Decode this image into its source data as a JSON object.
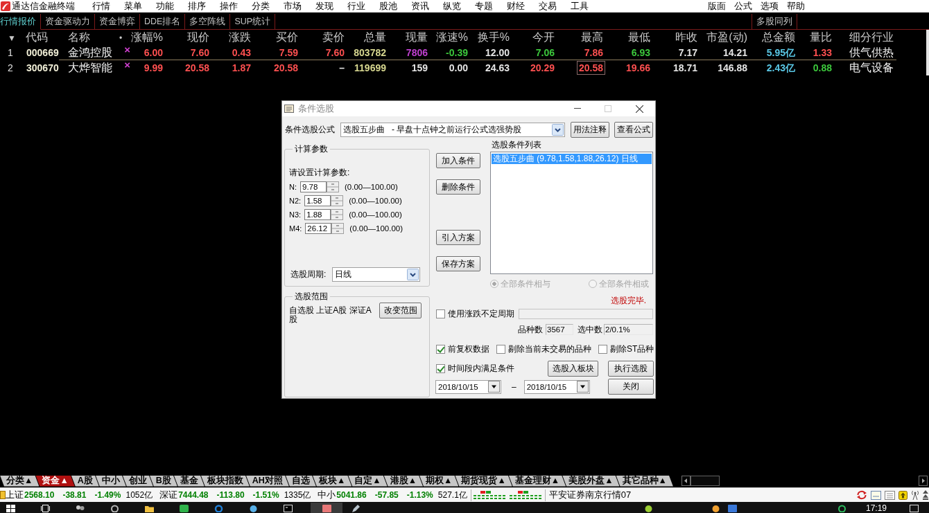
{
  "app": {
    "title": "通达信金融终端",
    "menu": [
      "行情",
      "菜单",
      "功能",
      "排序",
      "操作",
      "分类",
      "市场",
      "发现",
      "行业",
      "股池",
      "资讯",
      "纵览",
      "专题",
      "财经",
      "交易",
      "工具"
    ],
    "menu_right": [
      "版面",
      "公式",
      "选项",
      "帮助"
    ]
  },
  "view_tabs": [
    {
      "label": "行情报价",
      "selected": true
    },
    {
      "label": "资金驱动力",
      "selected": false
    },
    {
      "label": "资金博弈",
      "selected": false
    },
    {
      "label": "DDE排名",
      "selected": false
    },
    {
      "label": "多空阵线",
      "selected": false
    },
    {
      "label": "SUP统计",
      "selected": false
    }
  ],
  "view_tabs_right": [
    {
      "label": "多股同列",
      "selected": false
    }
  ],
  "quote_table": {
    "columns": [
      "▼",
      "代码",
      "名称",
      "•",
      "涨幅%",
      "现价",
      "涨跌",
      "买价",
      "卖价",
      "总量",
      "现量",
      "涨速%",
      "换手%",
      "今开",
      "最高",
      "最低",
      "昨收",
      "市盈(动)",
      "总金额",
      "量比",
      "细分行业"
    ],
    "rows": [
      {
        "selected": true,
        "cells": [
          {
            "text": "1",
            "color": "#e0e0e0",
            "boxed": false
          },
          {
            "text": "000669",
            "color": "#f2f0d8",
            "boxed": false
          },
          {
            "text": "金鸿控股",
            "color": "#f2f2f2",
            "boxed": false
          },
          {
            "text": "×",
            "color": "#d040d0",
            "boxed": false
          },
          {
            "text": "6.00",
            "color": "#ff5050",
            "boxed": false
          },
          {
            "text": "7.60",
            "color": "#ff5050",
            "boxed": false
          },
          {
            "text": "0.43",
            "color": "#ff5050",
            "boxed": false
          },
          {
            "text": "7.59",
            "color": "#ff5050",
            "boxed": false
          },
          {
            "text": "7.60",
            "color": "#ff5050",
            "boxed": false
          },
          {
            "text": "803782",
            "color": "#d8d890",
            "boxed": false
          },
          {
            "text": "7806",
            "color": "#c040d0",
            "boxed": false
          },
          {
            "text": "-0.39",
            "color": "#3cc83c",
            "boxed": false
          },
          {
            "text": "12.00",
            "color": "#e6e6e6",
            "boxed": false
          },
          {
            "text": "7.06",
            "color": "#3cc83c",
            "boxed": false
          },
          {
            "text": "7.86",
            "color": "#ff5050",
            "boxed": false
          },
          {
            "text": "6.93",
            "color": "#3cc83c",
            "boxed": false
          },
          {
            "text": "7.17",
            "color": "#e6e6e6",
            "boxed": false
          },
          {
            "text": "14.21",
            "color": "#e6e6e6",
            "boxed": false
          },
          {
            "text": "5.95亿",
            "color": "#5ac8e6",
            "boxed": false
          },
          {
            "text": "1.33",
            "color": "#ff5050",
            "boxed": false
          },
          {
            "text": "供气供热",
            "color": "#f2f2f2",
            "boxed": false
          }
        ]
      },
      {
        "selected": false,
        "cells": [
          {
            "text": "2",
            "color": "#e0e0e0",
            "boxed": false
          },
          {
            "text": "300670",
            "color": "#f2f0d8",
            "boxed": false
          },
          {
            "text": "大烨智能",
            "color": "#f2f2f2",
            "boxed": false
          },
          {
            "text": "×",
            "color": "#d040d0",
            "boxed": false
          },
          {
            "text": "9.99",
            "color": "#ff5050",
            "boxed": false
          },
          {
            "text": "20.58",
            "color": "#ff5050",
            "boxed": false
          },
          {
            "text": "1.87",
            "color": "#ff5050",
            "boxed": false
          },
          {
            "text": "20.58",
            "color": "#ff5050",
            "boxed": false
          },
          {
            "text": "–",
            "color": "#e6e6e6",
            "boxed": false
          },
          {
            "text": "119699",
            "color": "#d8d890",
            "boxed": false
          },
          {
            "text": "159",
            "color": "#e6e6e6",
            "boxed": false
          },
          {
            "text": "0.00",
            "color": "#e6e6e6",
            "boxed": false
          },
          {
            "text": "24.63",
            "color": "#e6e6e6",
            "boxed": false
          },
          {
            "text": "20.29",
            "color": "#ff5050",
            "boxed": false
          },
          {
            "text": "20.58",
            "color": "#ff5050",
            "boxed": true
          },
          {
            "text": "19.66",
            "color": "#ff5050",
            "boxed": false
          },
          {
            "text": "18.71",
            "color": "#e6e6e6",
            "boxed": false
          },
          {
            "text": "146.88",
            "color": "#e6e6e6",
            "boxed": false
          },
          {
            "text": "2.43亿",
            "color": "#5ac8e6",
            "boxed": false
          },
          {
            "text": "0.88",
            "color": "#3cc83c",
            "boxed": false
          },
          {
            "text": "电气设备",
            "color": "#f2f2f2",
            "boxed": false
          }
        ]
      }
    ]
  },
  "dialog": {
    "title": "条件选股",
    "formula": {
      "label": "条件选股公式",
      "value": "选股五步曲   - 早盘十点钟之前运行公式选强势股"
    },
    "top_buttons": [
      "用法注释",
      "查看公式"
    ],
    "params_group": {
      "title": "计算参数",
      "prompt": "请设置计算参数:",
      "params": [
        {
          "name": "N:",
          "value": "9.78",
          "range": "(0.00—100.00)"
        },
        {
          "name": "N2:",
          "value": "1.58",
          "range": "(0.00—100.00)"
        },
        {
          "name": "N3:",
          "value": "1.88",
          "range": "(0.00—100.00)"
        },
        {
          "name": "M4:",
          "value": "26.12",
          "range": "(0.00—100.00)"
        }
      ],
      "period": {
        "label": "选股周期:",
        "value": "日线"
      }
    },
    "scope_group": {
      "title": "选股范围",
      "text": "自选股 上证A股 深证A股",
      "button": "改变范围"
    },
    "action_buttons": [
      "加入条件",
      "删除条件",
      "引入方案",
      "保存方案"
    ],
    "condition_list": {
      "label": "选股条件列表",
      "items": [
        {
          "text": "选股五步曲 (9.78,1.58,1.88,26.12) 日线",
          "selected": true
        }
      ]
    },
    "logic": [
      {
        "label": "全部条件相与",
        "selected": true,
        "disabled": true
      },
      {
        "label": "全部条件相或",
        "selected": false,
        "disabled": true
      }
    ],
    "status_text": "选股完毕.",
    "variable_period": {
      "label": "使用涨跌不定周期",
      "checked": false
    },
    "counts": [
      {
        "label": "品种数",
        "value": "3567"
      },
      {
        "label": "选中数",
        "value": "2/0.1%"
      }
    ],
    "options": [
      {
        "label": "前复权数据",
        "checked": true
      },
      {
        "label": "剔除当前未交易的品种",
        "checked": false
      },
      {
        "label": "剔除ST品种",
        "checked": false
      }
    ],
    "time_range": {
      "label": "时间段内满足条件",
      "checked": true,
      "from": "2018/10/15",
      "separator": "–",
      "to": "2018/10/15"
    },
    "bottom_buttons": [
      "选股入板块",
      "执行选股",
      "关闭"
    ]
  },
  "market_tabs": [
    {
      "label": "分类▲",
      "selected": false
    },
    {
      "label": "资金▲",
      "selected": true
    },
    {
      "label": "A股",
      "selected": false
    },
    {
      "label": "中小",
      "selected": false
    },
    {
      "label": "创业",
      "selected": false
    },
    {
      "label": "B股",
      "selected": false
    },
    {
      "label": "基金",
      "selected": false
    },
    {
      "label": "板块指数",
      "selected": false
    },
    {
      "label": "AH对照",
      "selected": false
    },
    {
      "label": "自选",
      "selected": false
    },
    {
      "label": "板块▲",
      "selected": false
    },
    {
      "label": "自定▲",
      "selected": false
    },
    {
      "label": "港股▲",
      "selected": false
    },
    {
      "label": "期权▲",
      "selected": false
    },
    {
      "label": "期货现货▲",
      "selected": false
    },
    {
      "label": "基金理财▲",
      "selected": false
    },
    {
      "label": "美股外盘▲",
      "selected": false
    },
    {
      "label": "其它品种▲",
      "selected": false
    }
  ],
  "status_bar": {
    "indices": [
      {
        "name": "上证",
        "value": "2568.10",
        "change": "-38.81",
        "percent": "-1.49%",
        "amount": "1052亿",
        "color": "#008000"
      },
      {
        "name": "深证",
        "value": "7444.48",
        "change": "-113.80",
        "percent": "-1.51%",
        "amount": "1335亿",
        "color": "#008000"
      },
      {
        "name": "中小",
        "value": "5041.86",
        "change": "-57.85",
        "percent": "-1.13%",
        "amount": "527.1亿",
        "color": "#008000"
      }
    ],
    "server": "平安证券南京行情07"
  },
  "taskbar": {
    "time": "17:19"
  }
}
